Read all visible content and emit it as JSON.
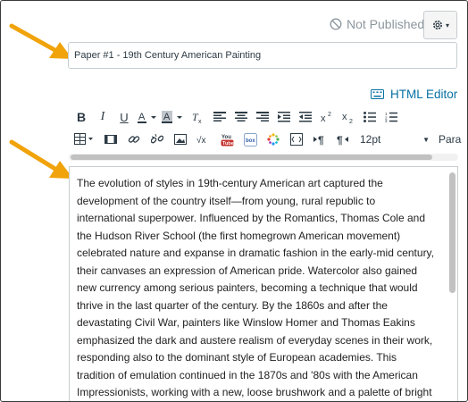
{
  "status": {
    "label": "Not Published",
    "icon": "not-published-icon",
    "color": "#8b969e"
  },
  "settings": {
    "icon": "gear-icon",
    "caret": "▾"
  },
  "title_input": {
    "value": "Paper #1 - 19th Century American Painting"
  },
  "html_editor": {
    "label": "HTML Editor",
    "icon": "keyboard-icon",
    "color": "#0770a3"
  },
  "toolbar": {
    "font_size": "12pt",
    "paragraph": "Para"
  },
  "arrows": {
    "color": "#f0a30a"
  },
  "editor": {
    "lines": [
      "The evolution of styles in 19th-century American art captured the",
      "development of the country itself—from young, rural republic to",
      "international superpower. Influenced by the Romantics, Thomas Cole and",
      "the Hudson River School (the first homegrown American movement)",
      "celebrated nature and expanse in dramatic fashion in the early-mid century,",
      "their canvases an expression of American pride. Watercolor also gained",
      "new currency among serious painters, becoming a technique that would",
      "thrive in the last quarter of the century. By the 1860s and after the",
      "devastating Civil War, painters like Winslow Homer and Thomas Eakins",
      "emphasized the dark and austere realism of everyday scenes in their work,",
      "responding also to the dominant style of European academies. This",
      "tradition of emulation continued in the 1870s and '80s with the American",
      "Impressionists, working with a new, loose brushwork and a palette of bright color"
    ]
  }
}
